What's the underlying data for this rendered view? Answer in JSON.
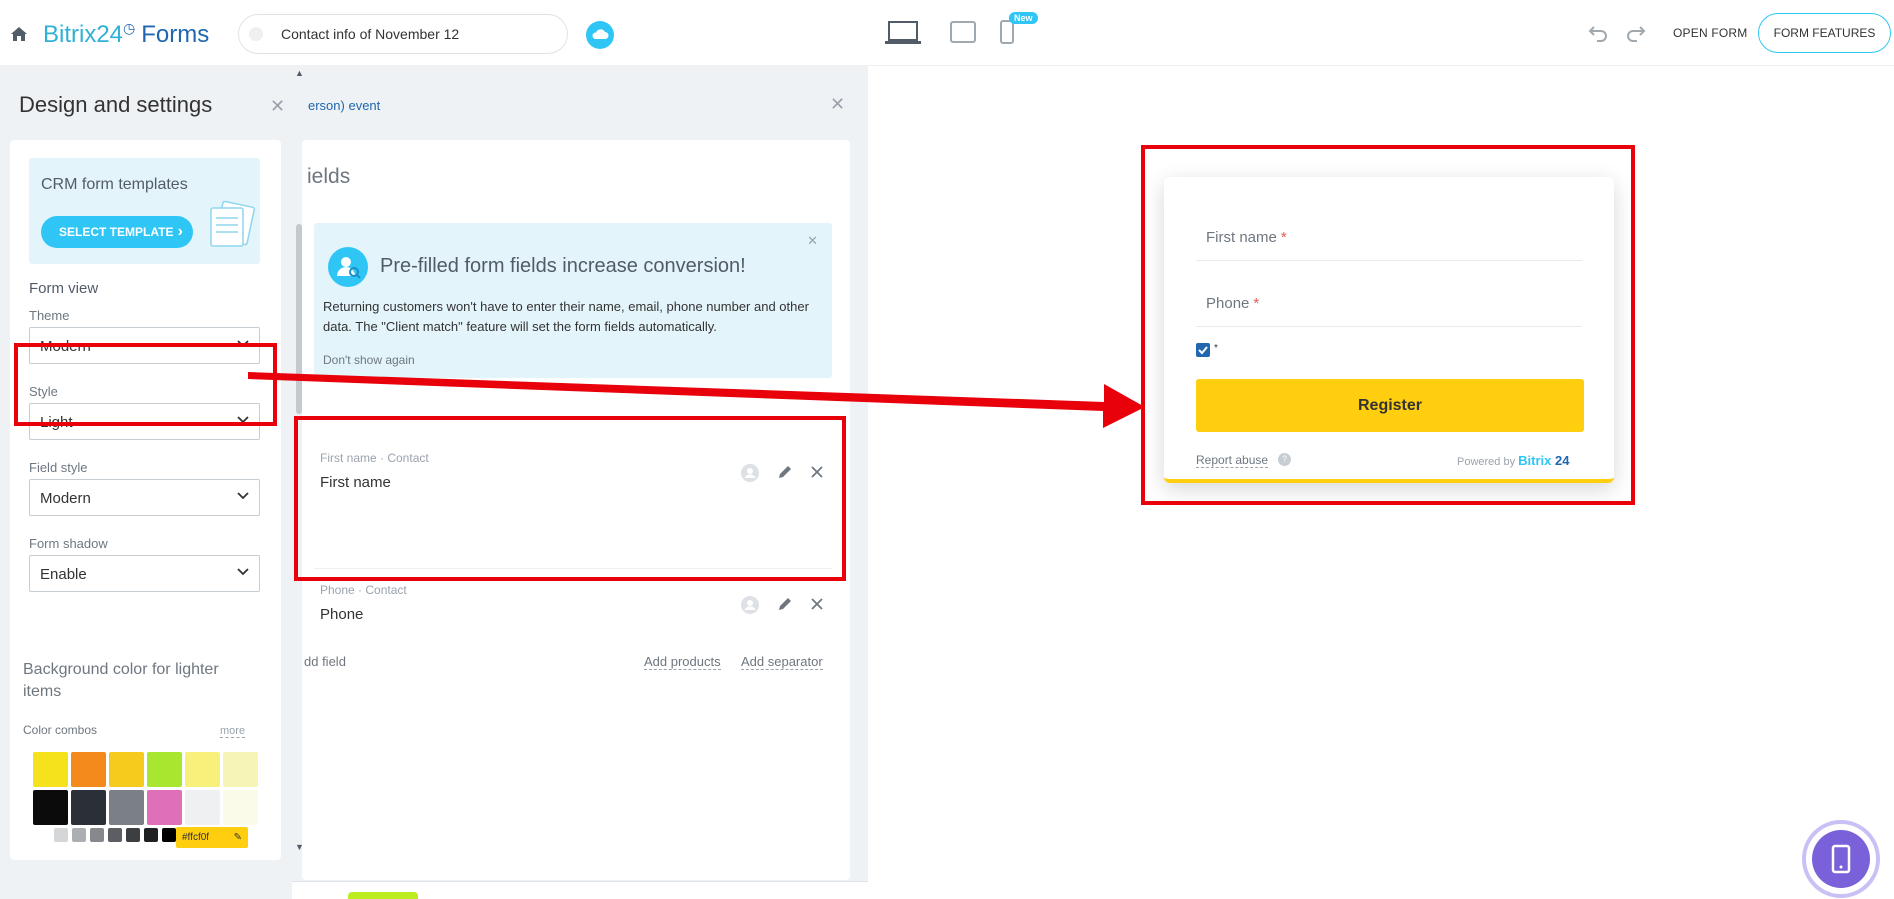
{
  "topbar": {
    "logo_brand": "Bitrix24",
    "logo_product": "Forms",
    "form_name": "Contact info of November 12",
    "new_badge": "New",
    "open_form": "OPEN FORM",
    "form_features": "FORM FEATURES"
  },
  "design": {
    "title": "Design and settings",
    "crm_templates": "CRM form templates",
    "select_template": "SELECT TEMPLATE",
    "form_view": "Form view",
    "theme_label": "Theme",
    "theme_value": "Modern",
    "style_label": "Style",
    "style_value": "Light",
    "field_style_label": "Field style",
    "field_style_value": "Modern",
    "shadow_label": "Form shadow",
    "shadow_value": "Enable",
    "bg_color_title": "Background color for lighter items",
    "color_combos": "Color combos",
    "more": "more",
    "hex_value": "#ffcf0f",
    "swatches_row1": [
      "#f6e21c",
      "#f48a1c",
      "#f7cb1d",
      "#a8e630",
      "#f7f07a",
      "#f7f5b6"
    ],
    "swatches_row2": [
      "#0b0b0b",
      "#2a2f38",
      "#7b7f86",
      "#e06fba",
      "#eef0f2",
      "#fbfbe9"
    ],
    "mini_swatches": [
      "#ffffff",
      "#d4d6d8",
      "#acafb2",
      "#85898d",
      "#5b5f63",
      "#3c3f42",
      "#1e2022",
      "#000000"
    ]
  },
  "fields": {
    "event_text": "erson) event",
    "section_title": "ields",
    "prefill_heading": "Pre-filled form fields increase conversion!",
    "prefill_text": "Returning customers won't have to enter their name, email, phone number and other data. The \"Client match\" feature will set the form fields automatically.",
    "dont_show": "Don't show again",
    "rows": [
      {
        "caption": "First name · Contact",
        "value": "First name"
      },
      {
        "caption": "Phone · Contact",
        "value": "Phone"
      }
    ],
    "add_field": "dd field",
    "add_products": "Add products",
    "add_separator": "Add separator"
  },
  "preview": {
    "first_name": "First name",
    "phone": "Phone",
    "required_mark": "*",
    "checkbox_mark": "*",
    "register": "Register",
    "report_abuse": "Report abuse",
    "help": "?",
    "powered_by": "Powered by",
    "powered_brand": "Bitrix",
    "powered_brand_num": "24"
  },
  "colors": {
    "accent": "#2fc6f6",
    "brand_dark": "#2067b0",
    "button": "#ffcf0f",
    "annotation": "#e8000b"
  }
}
